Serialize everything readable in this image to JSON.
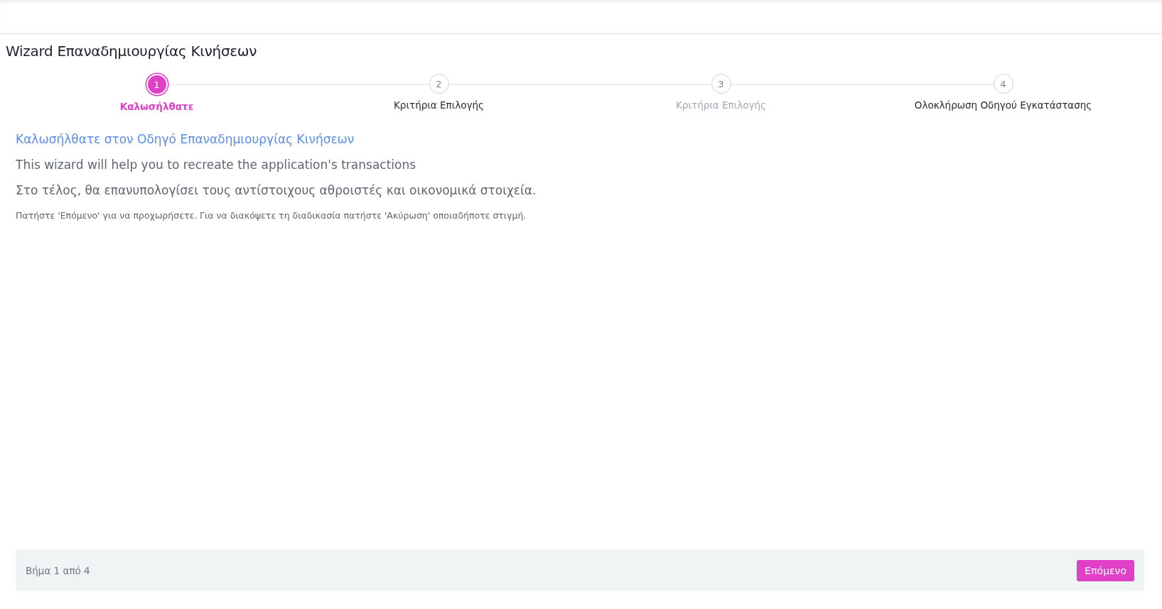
{
  "page": {
    "title": "Wizard Επαναδημιουργίας Κινήσεων"
  },
  "steps": [
    {
      "number": "1",
      "label": "Καλωσήλθατε",
      "selected": true,
      "disabled": false
    },
    {
      "number": "2",
      "label": "Κριτήρια Επιλογής",
      "selected": false,
      "disabled": false
    },
    {
      "number": "3",
      "label": "Κριτήρια Επιλογής",
      "selected": false,
      "disabled": true
    },
    {
      "number": "4",
      "label": "Ολοκλήρωση Οδηγού Εγκατάστασης",
      "selected": false,
      "disabled": false
    }
  ],
  "content": {
    "heading": "Καλωσήλθατε στον Οδηγό Επαναδημιουργίας Κινήσεων",
    "paragraphs": [
      "This wizard will help you to recreate the application's transactions",
      "Στο τέλος, θα επανυπολογίσει τους αντίστοιχους αθροιστές και οικονομικά στοιχεία."
    ],
    "hint": "Πατήστε 'Επόμενο' για να προχωρήσετε. Για να διακόψετε τη διαδικασία πατήστε 'Ακύρωση' οποιαδήποτε στιγμή."
  },
  "footer": {
    "step_text": "Βήμα 1 από 4",
    "next_button": "Επόμενο"
  }
}
